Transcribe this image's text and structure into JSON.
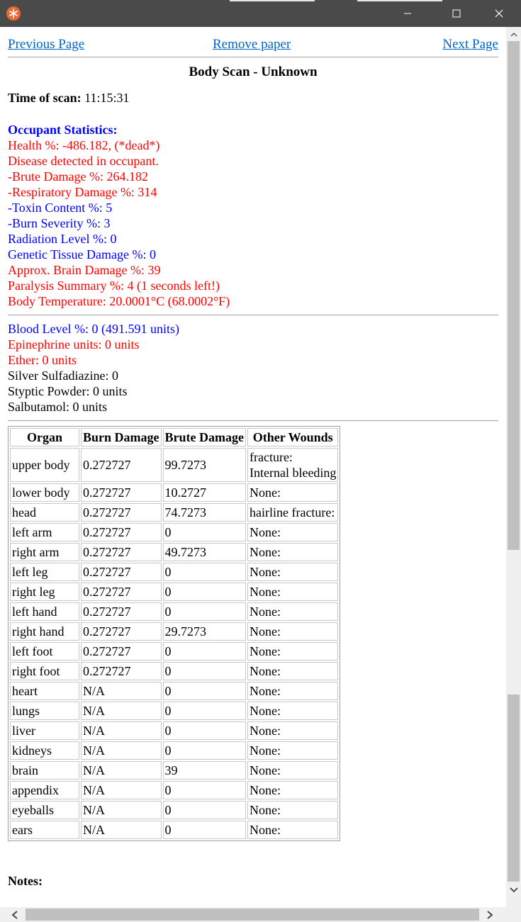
{
  "window": {
    "minimize_glyph": "—",
    "maximize_glyph": "☐",
    "close_glyph": "✕",
    "icon": "app-snowflake-icon",
    "accent": "#e86a32"
  },
  "nav": {
    "previous": "Previous Page",
    "remove": "Remove paper",
    "next": "Next Page"
  },
  "title": "Body Scan - Unknown",
  "scan": {
    "time_label": "Time of scan:",
    "time_value": "11:15:31"
  },
  "stats": {
    "heading": "Occupant Statistics:",
    "lines": [
      {
        "text": "Health %: -486.182, (*dead*)",
        "color": "red"
      },
      {
        "text": "Disease detected in occupant.",
        "color": "red"
      },
      {
        "text": "-Brute Damage %: 264.182",
        "color": "red"
      },
      {
        "text": "-Respiratory Damage %: 314",
        "color": "red"
      },
      {
        "text": "-Toxin Content %: 5",
        "color": "blue"
      },
      {
        "text": "-Burn Severity %: 3",
        "color": "blue"
      },
      {
        "text": "Radiation Level %: 0",
        "color": "blue"
      },
      {
        "text": "Genetic Tissue Damage %: 0",
        "color": "blue"
      },
      {
        "text": "Approx. Brain Damage %: 39",
        "color": "red"
      },
      {
        "text": "Paralysis Summary %: 4 (1 seconds left!)",
        "color": "red"
      },
      {
        "text": "Body Temperature: 20.0001°C (68.0002°F)",
        "color": "red"
      }
    ]
  },
  "blood": {
    "lines": [
      {
        "text": "Blood Level %: 0 (491.591 units)",
        "color": "blue"
      },
      {
        "text": "Epinephrine units: 0 units",
        "color": "red"
      },
      {
        "text": "Ether: 0 units",
        "color": "red"
      },
      {
        "text": "Silver Sulfadiazine: 0",
        "color": "black"
      },
      {
        "text": "Styptic Powder: 0 units",
        "color": "black"
      },
      {
        "text": "Salbutamol: 0 units",
        "color": "black"
      }
    ]
  },
  "organ_table": {
    "headers": [
      "Organ",
      "Burn Damage",
      "Brute Damage",
      "Other Wounds"
    ],
    "rows": [
      [
        "upper body",
        "0.272727",
        "99.7273",
        "fracture:\nInternal bleeding"
      ],
      [
        "lower body",
        "0.272727",
        "10.2727",
        "None:"
      ],
      [
        "head",
        "0.272727",
        "74.7273",
        "hairline fracture:"
      ],
      [
        "left arm",
        "0.272727",
        "0",
        "None:"
      ],
      [
        "right arm",
        "0.272727",
        "49.7273",
        "None:"
      ],
      [
        "left leg",
        "0.272727",
        "0",
        "None:"
      ],
      [
        "right leg",
        "0.272727",
        "0",
        "None:"
      ],
      [
        "left hand",
        "0.272727",
        "0",
        "None:"
      ],
      [
        "right hand",
        "0.272727",
        "29.7273",
        "None:"
      ],
      [
        "left foot",
        "0.272727",
        "0",
        "None:"
      ],
      [
        "right foot",
        "0.272727",
        "0",
        "None:"
      ],
      [
        "heart",
        "N/A",
        "0",
        "None:"
      ],
      [
        "lungs",
        "N/A",
        "0",
        "None:"
      ],
      [
        "liver",
        "N/A",
        "0",
        "None:"
      ],
      [
        "kidneys",
        "N/A",
        "0",
        "None:"
      ],
      [
        "brain",
        "N/A",
        "39",
        "None:"
      ],
      [
        "appendix",
        "N/A",
        "0",
        "None:"
      ],
      [
        "eyeballs",
        "N/A",
        "0",
        "None:"
      ],
      [
        "ears",
        "N/A",
        "0",
        "None:"
      ]
    ]
  },
  "notes_label": "Notes:"
}
